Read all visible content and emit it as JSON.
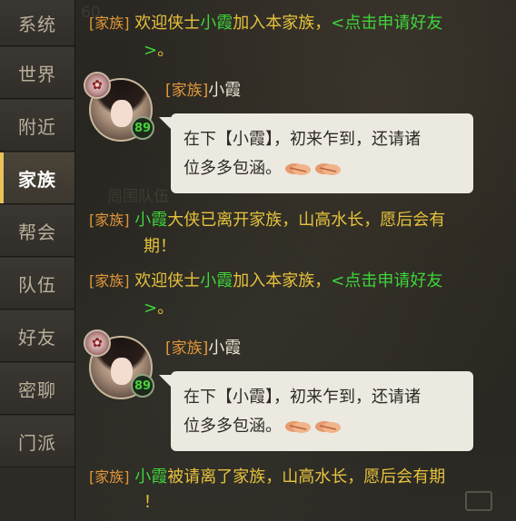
{
  "tabs": [
    {
      "label": "系统",
      "active": false
    },
    {
      "label": "世界",
      "active": false
    },
    {
      "label": "附近",
      "active": false
    },
    {
      "label": "家族",
      "active": true
    },
    {
      "label": "帮会",
      "active": false
    },
    {
      "label": "队伍",
      "active": false
    },
    {
      "label": "好友",
      "active": false
    },
    {
      "label": "密聊",
      "active": false
    },
    {
      "label": "门派",
      "active": false
    }
  ],
  "scene_text": {
    "left_number": "60",
    "middle_label": "周围队伍"
  },
  "messages": {
    "welcome1": {
      "channel": "[家族]",
      "pre": "欢迎侠士",
      "player": "小霞",
      "post": "加入本家族，",
      "link": "<点击申请好友",
      "link_end": ">",
      "end": "。"
    },
    "chat1": {
      "channel": "[家族]",
      "player": "小霞",
      "level": "89",
      "crest_icon": "sect-crest-icon",
      "text_line1": "在下【小霞】，初来乍到，还请诸",
      "text_line2": "位多多包涵。"
    },
    "leave": {
      "channel": "[家族]",
      "player": "小霞",
      "text": "大侠已离开家族，山高水长，愿后会有",
      "text2": "期！"
    },
    "welcome2": {
      "channel": "[家族]",
      "pre": "欢迎侠士",
      "player": "小霞",
      "post": "加入本家族，",
      "link": "<点击申请好友",
      "link_end": ">",
      "end": "。"
    },
    "chat2": {
      "channel": "[家族]",
      "player": "小霞",
      "level": "89",
      "crest_icon": "sect-crest-icon",
      "text_line1": "在下【小霞】，初来乍到，还请诸",
      "text_line2": "位多多包涵。"
    },
    "kicked": {
      "channel": "[家族]",
      "player": "小霞",
      "text": "被请离了家族，山高水长，愿后会有期",
      "text2": "！"
    }
  },
  "icons": {
    "emoji": "handshake-emoji-icon",
    "mail": "mail-icon"
  },
  "colors": {
    "channel": "#e0973a",
    "link": "#3fd43b",
    "player_orange": "#f08a2c",
    "active_tab_marker": "#e9c35a",
    "bubble": "#ece9e0"
  }
}
